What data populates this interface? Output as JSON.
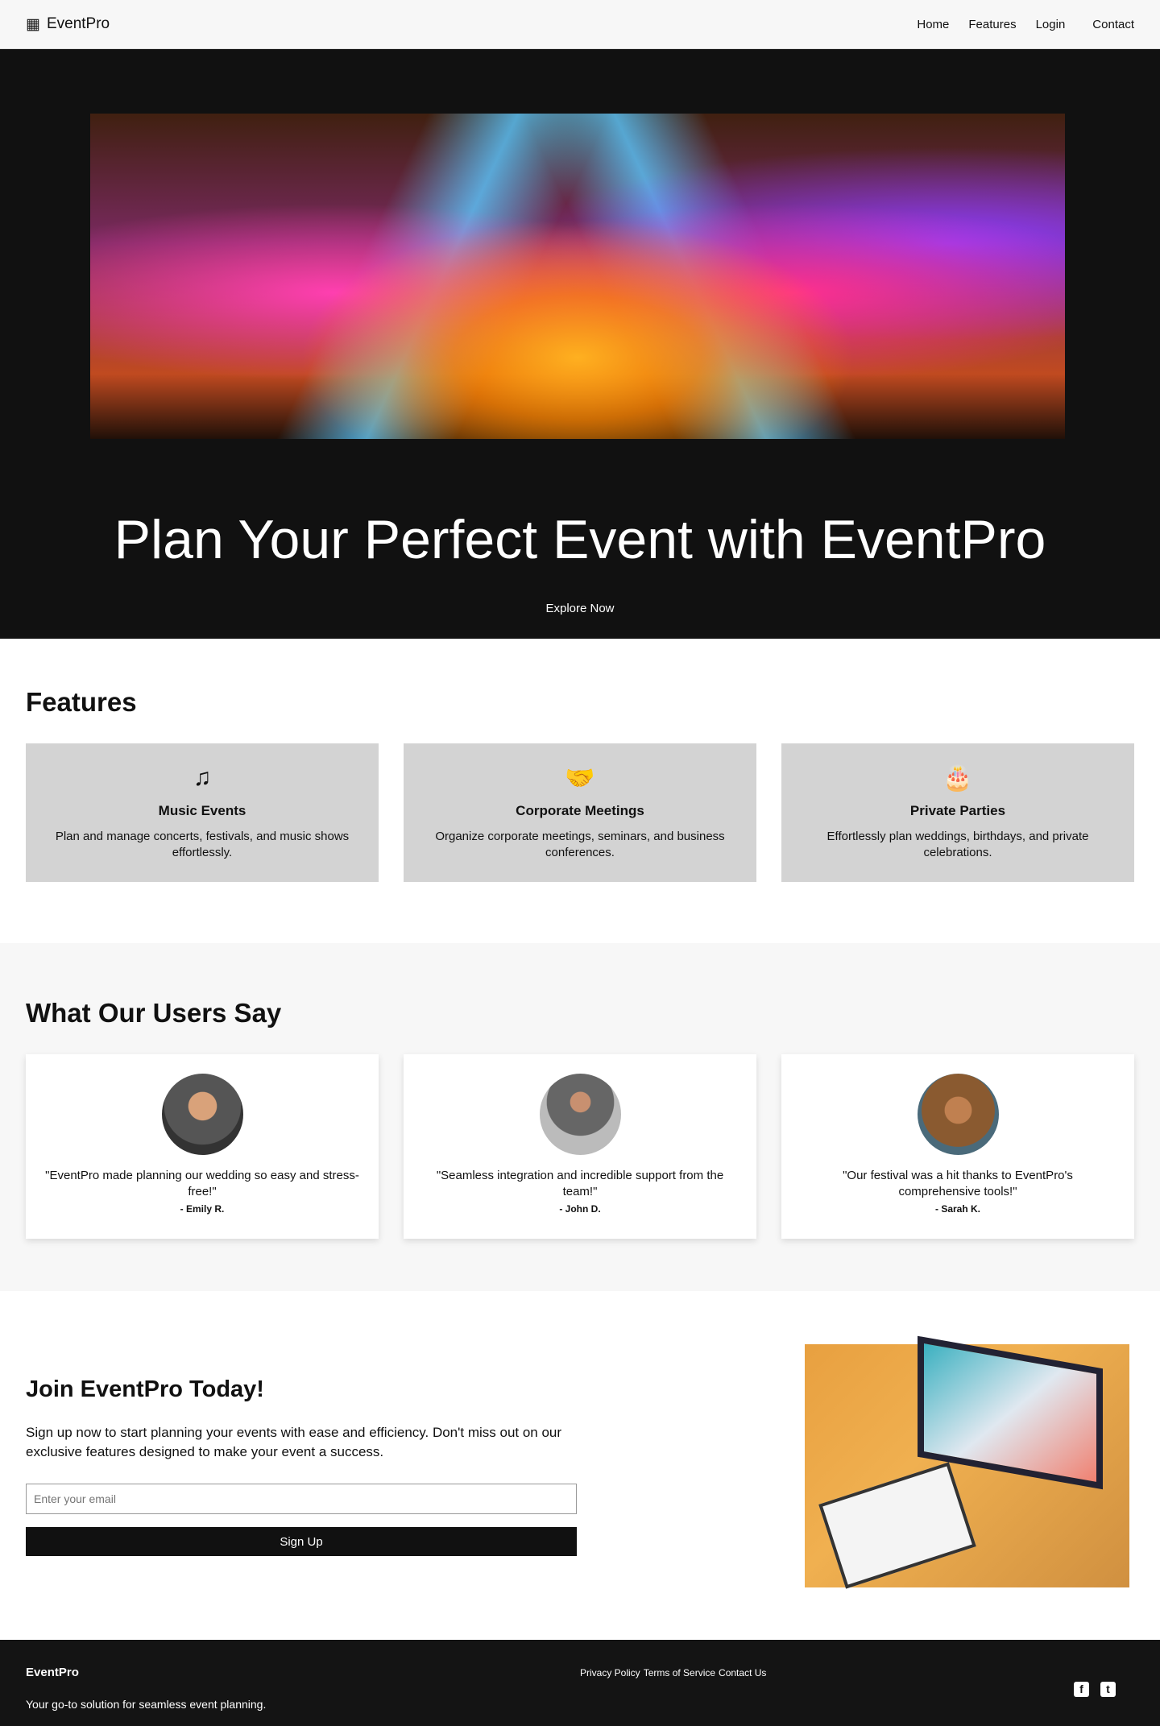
{
  "nav": {
    "brand": "EventPro",
    "brand_icon": "calendar-icon",
    "links": [
      "Home",
      "Features",
      "Login",
      "Contact"
    ]
  },
  "hero": {
    "title": "Plan Your Perfect Event with EventPro",
    "cta": "Explore Now"
  },
  "features": {
    "heading": "Features",
    "items": [
      {
        "icon": "music-icon",
        "title": "Music Events",
        "text": "Plan and manage concerts, festivals, and music shows effortlessly."
      },
      {
        "icon": "handshake-icon",
        "title": "Corporate Meetings",
        "text": "Organize corporate meetings, seminars, and business conferences."
      },
      {
        "icon": "birthday-cake-icon",
        "title": "Private Parties",
        "text": "Effortlessly plan weddings, birthdays, and private celebrations."
      }
    ]
  },
  "testimonials": {
    "heading": "What Our Users Say",
    "items": [
      {
        "quote": "\"EventPro made planning our wedding so easy and stress-free!\"",
        "author": "- Emily R."
      },
      {
        "quote": "\"Seamless integration and incredible support from the team!\"",
        "author": "- John D."
      },
      {
        "quote": "\"Our festival was a hit thanks to EventPro's comprehensive tools!\"",
        "author": "- Sarah K."
      }
    ]
  },
  "join": {
    "heading": "Join EventPro Today!",
    "text": "Sign up now to start planning your events with ease and efficiency. Don't miss out on our exclusive features designed to make your event a success.",
    "email_placeholder": "Enter your email",
    "button": "Sign Up"
  },
  "footer": {
    "brand": "EventPro",
    "tagline": "Your go-to solution for seamless event planning.",
    "links": [
      "Privacy Policy",
      "Terms of Service",
      "Contact Us"
    ],
    "social": [
      "facebook-icon",
      "twitter-icon"
    ]
  }
}
